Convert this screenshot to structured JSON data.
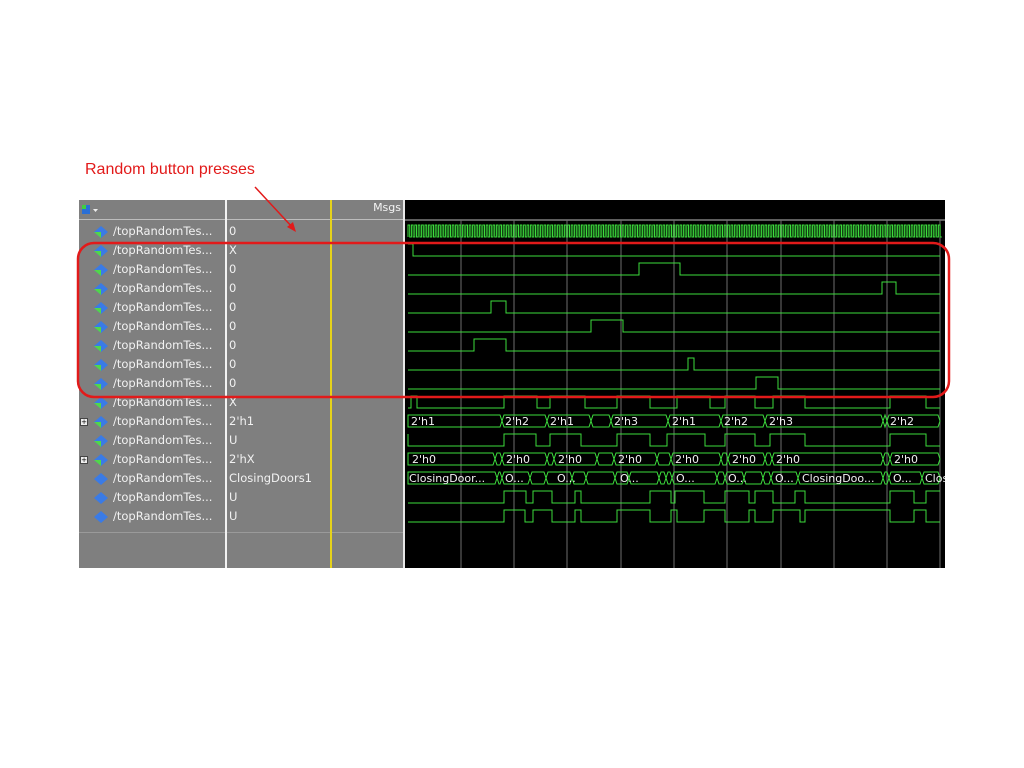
{
  "annotation": {
    "text": "Random button presses",
    "color": "#e21a1a"
  },
  "header": {
    "msgs_label": "Msgs"
  },
  "signals": [
    {
      "name": "/topRandomTes...",
      "value": "0",
      "type": "bit",
      "expand": false,
      "icon": "signal-icon"
    },
    {
      "name": "/topRandomTes...",
      "value": "X",
      "type": "bit",
      "expand": false,
      "icon": "signal-icon"
    },
    {
      "name": "/topRandomTes...",
      "value": "0",
      "type": "bit",
      "expand": false,
      "icon": "signal-icon"
    },
    {
      "name": "/topRandomTes...",
      "value": "0",
      "type": "bit",
      "expand": false,
      "icon": "signal-icon"
    },
    {
      "name": "/topRandomTes...",
      "value": "0",
      "type": "bit",
      "expand": false,
      "icon": "signal-icon"
    },
    {
      "name": "/topRandomTes...",
      "value": "0",
      "type": "bit",
      "expand": false,
      "icon": "signal-icon"
    },
    {
      "name": "/topRandomTes...",
      "value": "0",
      "type": "bit",
      "expand": false,
      "icon": "signal-icon"
    },
    {
      "name": "/topRandomTes...",
      "value": "0",
      "type": "bit",
      "expand": false,
      "icon": "signal-icon"
    },
    {
      "name": "/topRandomTes...",
      "value": "0",
      "type": "bit",
      "expand": false,
      "icon": "signal-icon"
    },
    {
      "name": "/topRandomTes...",
      "value": "X",
      "type": "bit",
      "expand": false,
      "icon": "signal-icon"
    },
    {
      "name": "/topRandomTes...",
      "value": "2'h1",
      "type": "bus",
      "expand": true,
      "icon": "bus-signal-icon"
    },
    {
      "name": "/topRandomTes...",
      "value": "U",
      "type": "bit",
      "expand": false,
      "icon": "signal-icon"
    },
    {
      "name": "/topRandomTes...",
      "value": "2'hX",
      "type": "bus",
      "expand": true,
      "icon": "bus-signal-icon"
    },
    {
      "name": "/topRandomTes...",
      "value": "ClosingDoors1",
      "type": "bus",
      "expand": false,
      "icon": "enum-signal-icon"
    },
    {
      "name": "/topRandomTes...",
      "value": "U",
      "type": "bit",
      "expand": false,
      "icon": "enum-signal-icon"
    },
    {
      "name": "/topRandomTes...",
      "value": "U",
      "type": "bit",
      "expand": false,
      "icon": "enum-signal-icon"
    }
  ],
  "bus_waves": {
    "row10": [
      "2'h1",
      "2'h2",
      "2'h1",
      "2'h3",
      "2'h1",
      "2'h2",
      "2'h3",
      "2'h2"
    ],
    "row12": [
      "2'h0",
      "2'h0",
      "2'h0",
      "2'h0",
      "2'h0",
      "2'h0",
      "2'h0",
      "2'h0"
    ],
    "row13": [
      "ClosingDoor...",
      "O...",
      "O...",
      "O...",
      "O...",
      "O...",
      "O...",
      "ClosingDoo...",
      "O...",
      "ClosingDo..."
    ]
  },
  "colors": {
    "wave": "#3ddc3d",
    "grid": "#6e6e6e",
    "annotation_box": "#e21a1a",
    "cursor": "#e6d21a"
  }
}
